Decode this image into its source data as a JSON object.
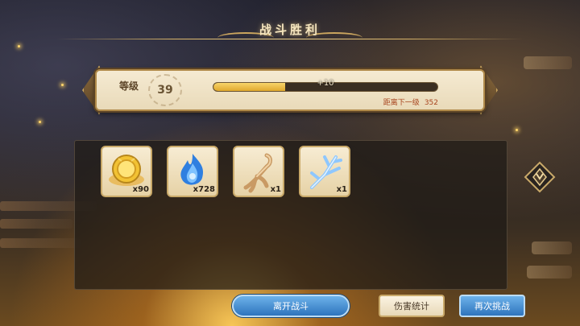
{
  "title": "战斗胜利",
  "level": {
    "label": "等级",
    "value": "39",
    "exp_gain": "+10",
    "exp_progress": 0.32,
    "remain_label": "距离下一级",
    "remain_value": "352"
  },
  "rewards": [
    {
      "icon": "gold-coin-icon",
      "qty": "x90"
    },
    {
      "icon": "blue-flame-icon",
      "qty": "x728"
    },
    {
      "icon": "ginseng-root-icon",
      "qty": "x1"
    },
    {
      "icon": "ice-branch-icon",
      "qty": "x1"
    }
  ],
  "buttons": {
    "leave": "离开战斗",
    "damage_stats": "伤害统计",
    "retry": "再次挑战"
  },
  "colors": {
    "exp_fill": "#e0a92e",
    "primary_button": "#2e74bd",
    "secondary_button": "#e8d9b8",
    "title_gold": "#f0d38c"
  }
}
